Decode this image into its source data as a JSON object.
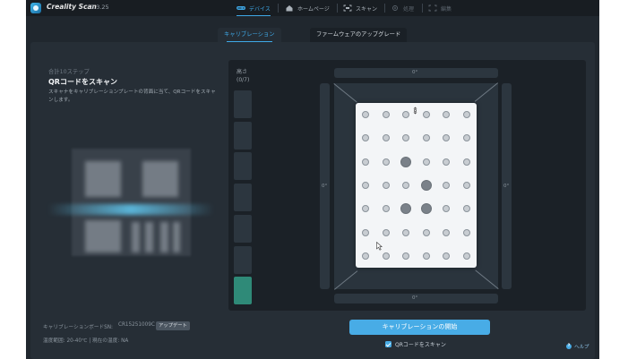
{
  "app": {
    "name": "Creality Scan",
    "version": "3.3.25"
  },
  "nav": {
    "items": [
      {
        "label": "デバイス",
        "icon": "link-icon",
        "state": "active"
      },
      {
        "label": "ホームページ",
        "icon": "home-icon",
        "state": "normal"
      },
      {
        "label": "スキャン",
        "icon": "scan-icon",
        "state": "normal"
      },
      {
        "label": "処理",
        "icon": "process-icon",
        "state": "disabled"
      },
      {
        "label": "編集",
        "icon": "edit-icon",
        "state": "disabled"
      }
    ]
  },
  "subtabs": [
    {
      "label": "キャリブレーション",
      "active": true
    },
    {
      "label": "ファームウェアのアップグレード",
      "active": false
    }
  ],
  "left": {
    "step": "合計10ステップ",
    "title": "QRコードをスキャン",
    "description": "スキャナをキャリブレーションプレートの背面に当て、QRコードをスキャンします。",
    "board_sn_label": "キャリブレーションボードSN:",
    "board_sn_value": "CR15251009C",
    "update_label": "アップデート",
    "temp": "温度範囲: 20-40℃ | 現在の温度: NA"
  },
  "height": {
    "label": "高さ",
    "count": "(0/7)",
    "segments_total": 7,
    "segments_done": 1
  },
  "platform": {
    "top_angle": "0°",
    "bottom_angle": "0°",
    "left_angle": "0°",
    "right_angle": "0°"
  },
  "actions": {
    "start_label": "キャリブレーションの開始",
    "qr_scan_label": "QRコードをスキャン",
    "qr_scan_checked": true,
    "help_label": "ヘルプ"
  },
  "colors": {
    "accent": "#48ace6",
    "done_segment": "#2f8a78",
    "panel": "#262e36"
  }
}
